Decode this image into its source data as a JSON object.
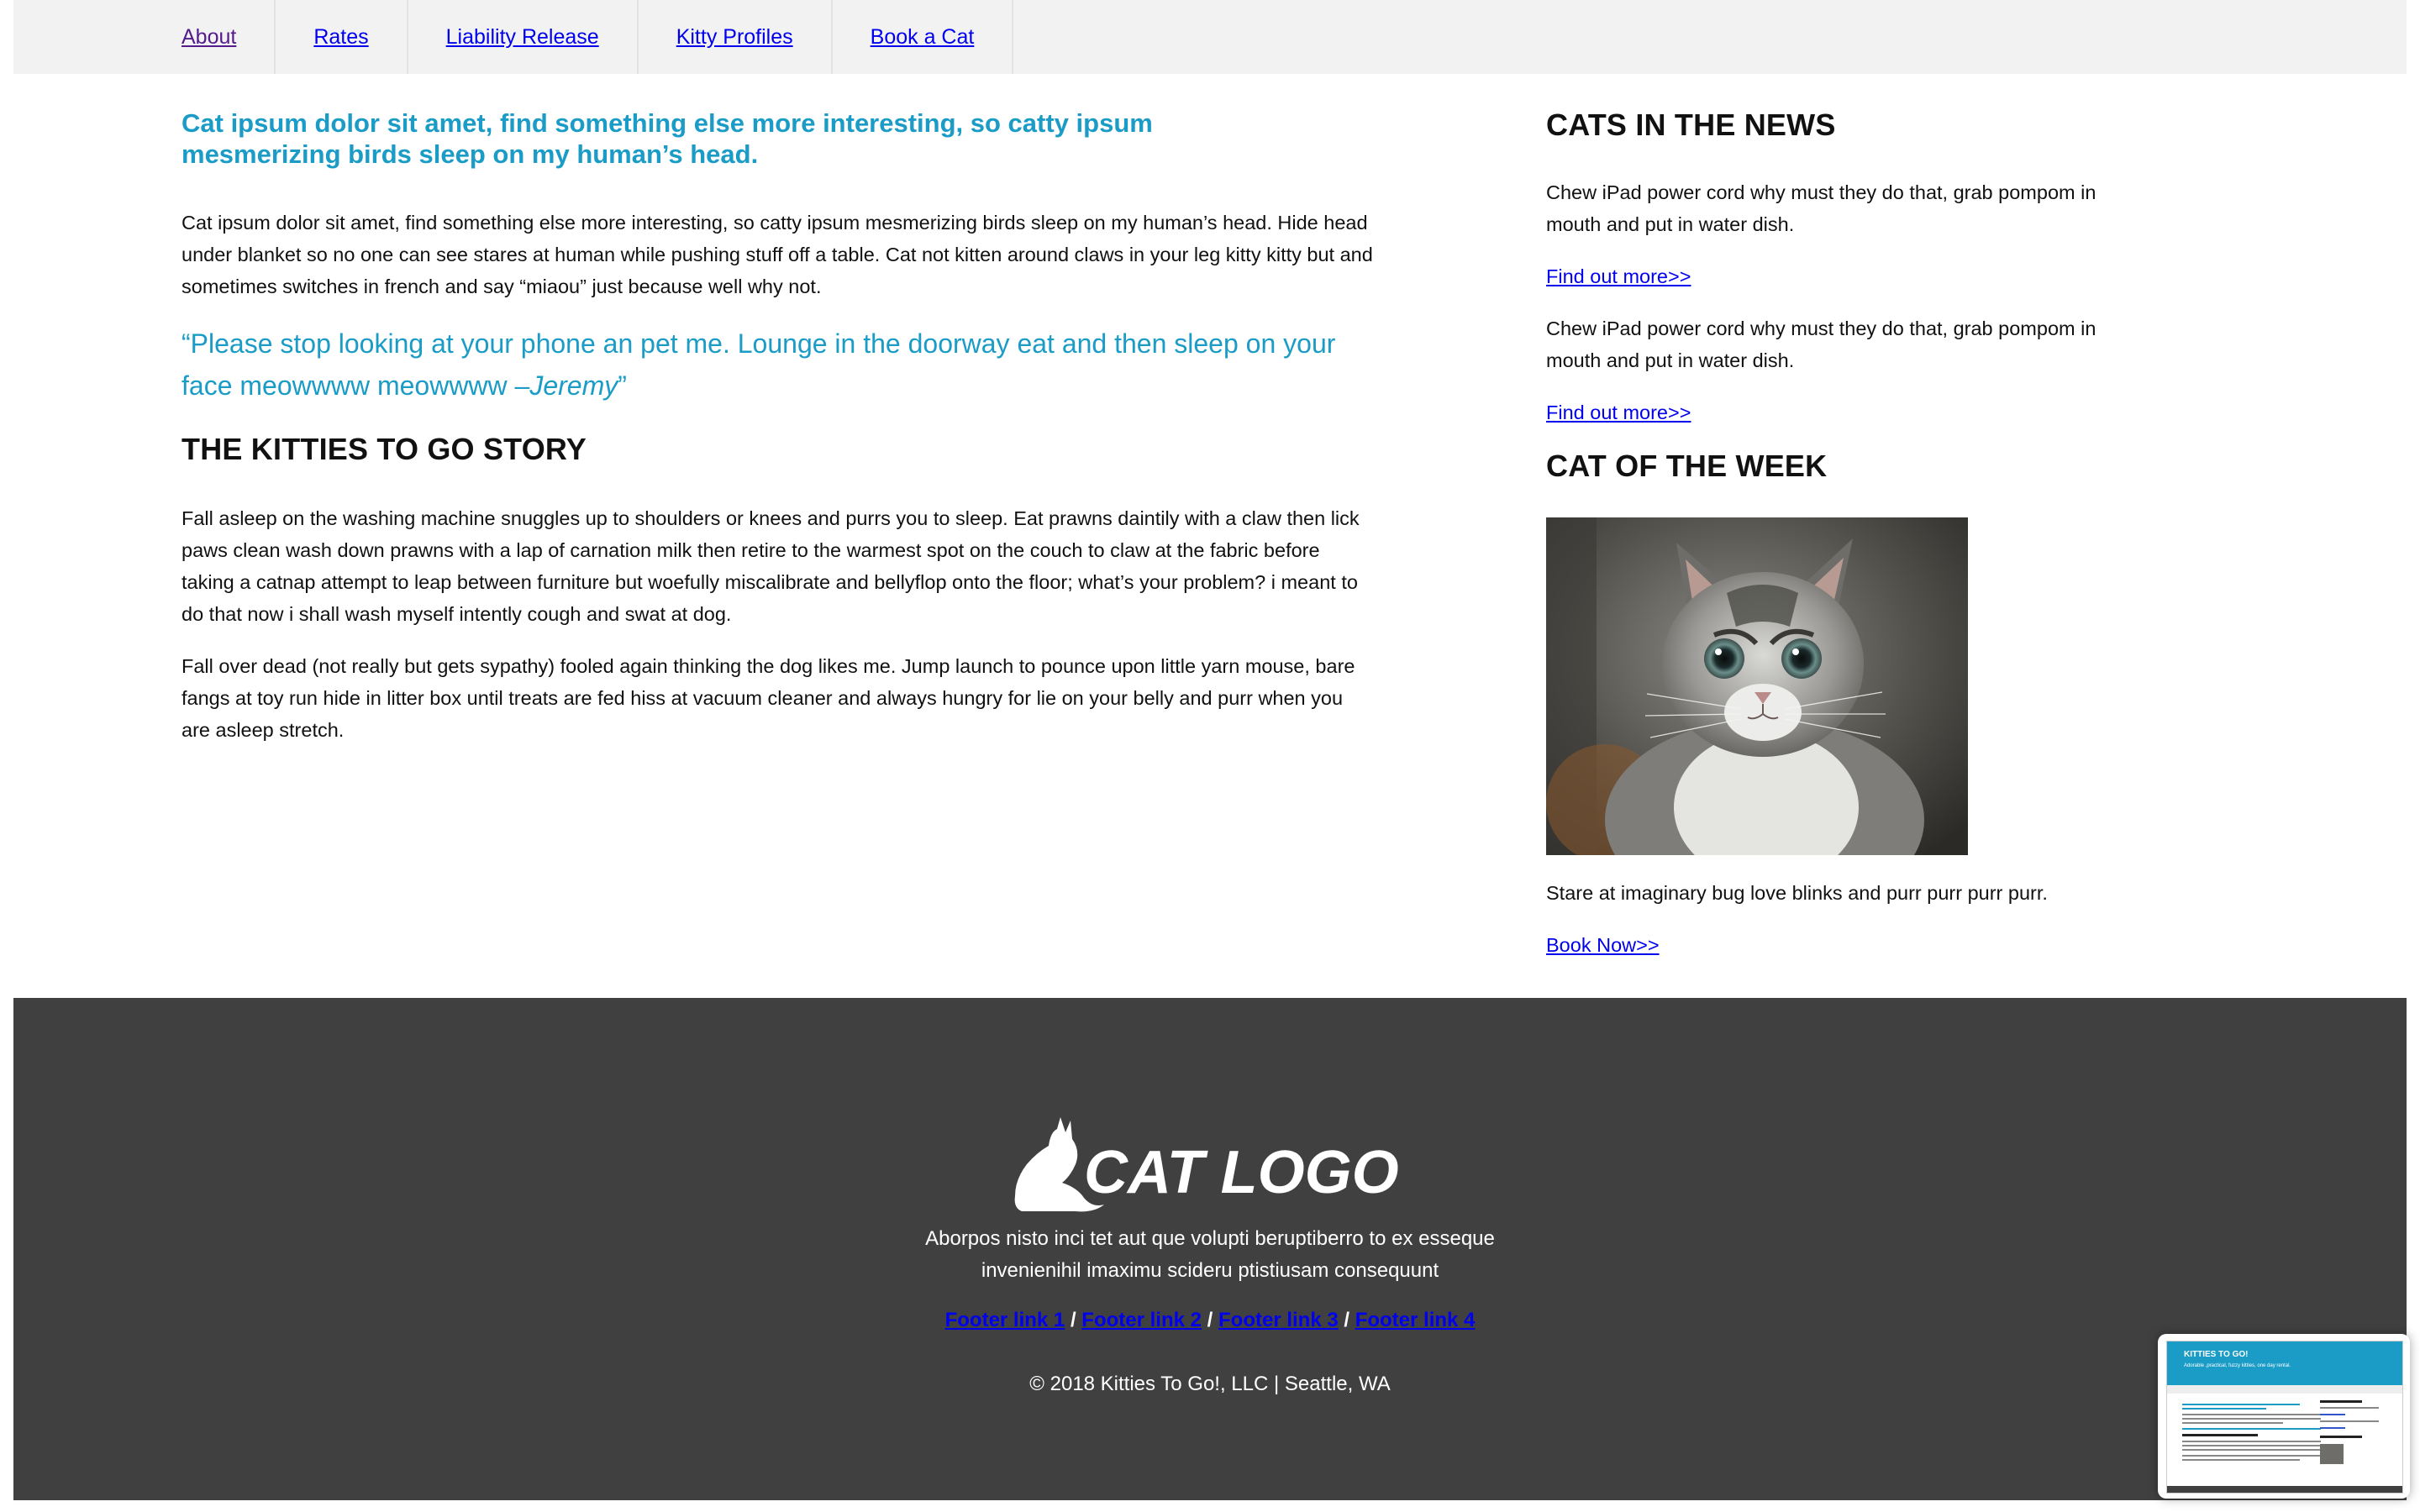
{
  "nav": {
    "items": [
      {
        "label": "About"
      },
      {
        "label": "Rates"
      },
      {
        "label": "Liability Release"
      },
      {
        "label": "Kitty Profiles"
      },
      {
        "label": "Book a Cat"
      }
    ]
  },
  "main": {
    "lead_line1": "Cat ipsum dolor sit amet, find something else more interesting, so catty ipsum",
    "lead_line2": "mesmerizing birds sleep on my human’s head.",
    "intro": "Cat ipsum dolor sit amet, find something else more interesting, so catty ipsum mesmerizing birds sleep on my human’s head. Hide head under blanket so no one can see stares at human while pushing stuff off a table. Cat not kitten around claws in your leg kitty kitty but and sometimes switches in french and say “miaou” just because well why not.",
    "quote_text": "“Please stop looking at your phone an pet me. Lounge in the doorway eat and then sleep on your face meowwww meowwww –",
    "quote_author": "Jeremy",
    "quote_close": "”",
    "story_heading": "THE KITTIES TO GO STORY",
    "story_p1": "Fall asleep on the washing machine snuggles up to shoulders or knees and purrs you to sleep. Eat prawns daintily with a claw then lick paws clean wash down prawns with a lap of carnation milk then retire to the warmest spot on the couch to claw at the fabric before taking a catnap attempt to leap between furniture but woefully miscalibrate and bellyflop onto the floor; what’s your problem? i meant to do that now i shall wash myself intently cough and swat at dog.",
    "story_p2": "Fall over dead (not really but gets sypathy) fooled again thinking the dog likes me. Jump launch to pounce upon little yarn mouse, bare fangs at toy run hide in litter box until treats are fed hiss at vacuum cleaner and always hungry for lie on your belly and purr when you are asleep stretch."
  },
  "sidebar": {
    "news_heading": "CATS IN THE NEWS",
    "news": [
      {
        "text": "Chew iPad power cord why must they do that, grab pompom in mouth and put in water dish.",
        "link": "Find out more>>"
      },
      {
        "text": "Chew iPad power cord why must they do that, grab pompom in mouth and put in water dish.",
        "link": "Find out more>>"
      }
    ],
    "cotw_heading": "CAT OF THE WEEK",
    "cotw_text": "Stare at imaginary bug love blinks and purr purr purr purr.",
    "cotw_link": "Book Now>>"
  },
  "footer": {
    "logo_text": "CAT LOGO",
    "blurb_line1": "Aborpos nisto inci tet aut que volupti beruptiberro to ex esseque",
    "blurb_line2": "invenienihil imaximu scideru ptistiusam consequunt",
    "links": [
      "Footer link 1",
      "Footer link 2",
      "Footer link 3",
      "Footer link 4"
    ],
    "separator": "/",
    "copyright": "© 2018 Kitties To Go!, LLC | Seattle, WA"
  },
  "thumbnail": {
    "title": "KITTIES TO GO!",
    "subtitle": "Adorable ,practical, fuzzy kitties, one day rental."
  },
  "colors": {
    "accent": "#1a9cc7",
    "footer_bg": "#404040",
    "nav_bg": "#f2f2f2",
    "link": "#0000ee"
  }
}
